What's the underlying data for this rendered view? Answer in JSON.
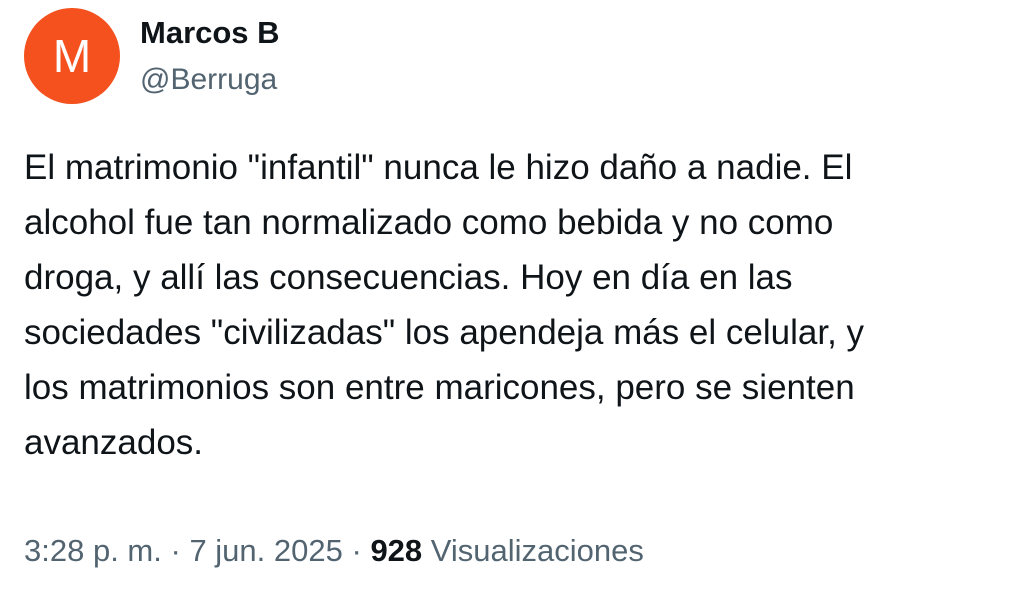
{
  "author": {
    "avatar_letter": "M",
    "avatar_color": "#f4511e",
    "display_name": "Marcos B",
    "handle": "@Berruga"
  },
  "post": {
    "lines": [
      "El matrimonio \"infantil\" nunca le hizo daño a nadie. El",
      "alcohol fue tan normalizado como bebida y no como",
      "droga, y allí las consecuencias. Hoy en día en las",
      "sociedades \"civilizadas\" los apendeja más el celular, y",
      "los matrimonios son entre maricones, pero se sienten",
      "avanzados."
    ]
  },
  "meta": {
    "time": "3:28 p. m.",
    "separator": "·",
    "date": "7 jun. 2025",
    "views_count": "928",
    "views_label": "Visualizaciones"
  },
  "colors": {
    "text_primary": "#0f1419",
    "text_secondary": "#536471"
  }
}
